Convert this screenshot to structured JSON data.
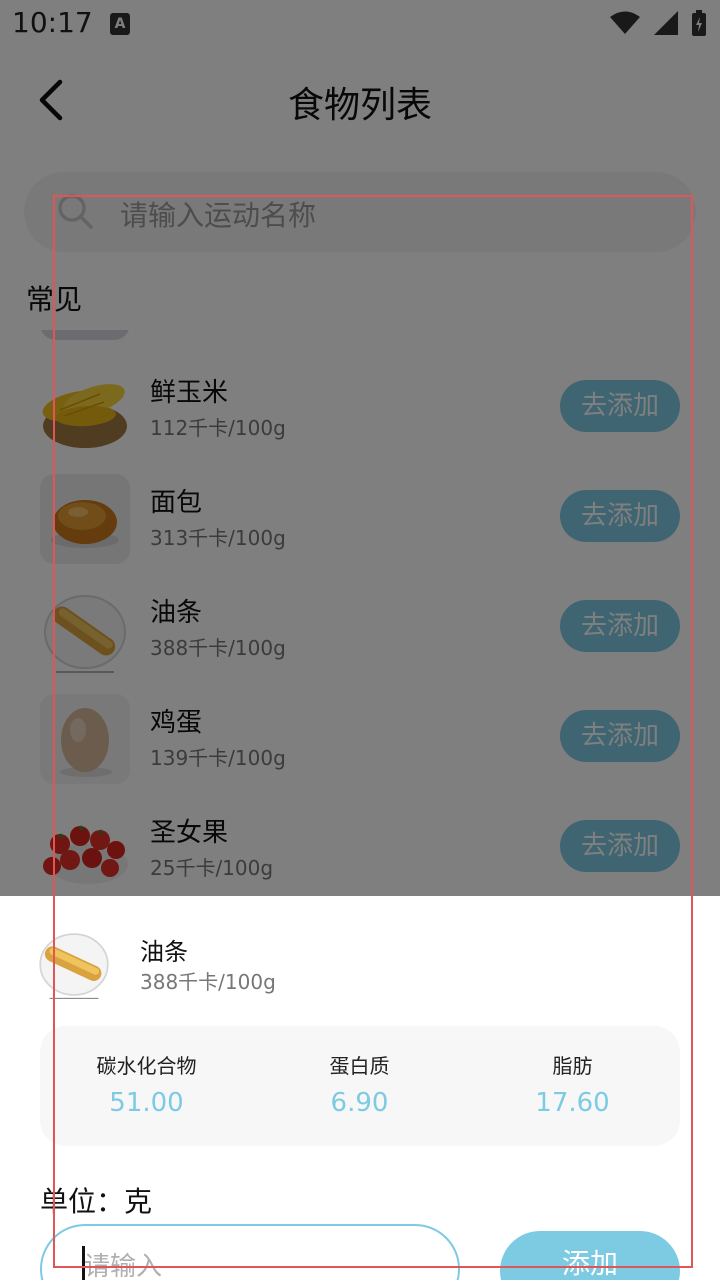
{
  "status_bar": {
    "time": "10:17",
    "notification_icon": "A"
  },
  "app_bar": {
    "title": "食物列表",
    "back_icon": "chevron-left-icon"
  },
  "search": {
    "placeholder": "请输入运动名称"
  },
  "section": {
    "label": "常见"
  },
  "foods": [
    {
      "name": "鲜玉米",
      "calories": "112千卡/100g",
      "button": "去添加",
      "image": "corn"
    },
    {
      "name": "面包",
      "calories": "313千卡/100g",
      "button": "去添加",
      "image": "bread"
    },
    {
      "name": "油条",
      "calories": "388千卡/100g",
      "button": "去添加",
      "image": "fried-dough-stick"
    },
    {
      "name": "鸡蛋",
      "calories": "139千卡/100g",
      "button": "去添加",
      "image": "egg"
    },
    {
      "name": "圣女果",
      "calories": "25千卡/100g",
      "button": "去添加",
      "image": "cherry-tomatoes"
    }
  ],
  "sheet": {
    "name": "油条",
    "calories": "388千卡/100g",
    "nutrients": [
      {
        "label": "碳水化合物",
        "value": "51.00"
      },
      {
        "label": "蛋白质",
        "value": "6.90"
      },
      {
        "label": "脂肪",
        "value": "17.60"
      }
    ],
    "unit_label": "单位：克",
    "input_placeholder": "请输入",
    "confirm_button": "添加"
  },
  "colors": {
    "accent": "#7ccbe3",
    "highlight": "#e05555",
    "overlay": "rgba(0,0,0,0.5)"
  }
}
